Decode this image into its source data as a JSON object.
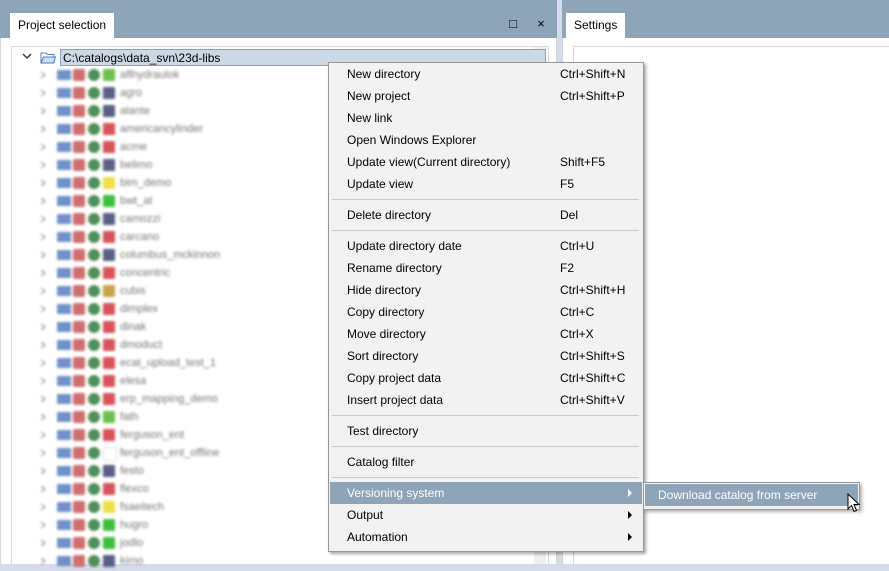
{
  "left_panel": {
    "tab_label": "Project selection",
    "restore_glyph": "□",
    "close_glyph": "×",
    "root_path": "C:\\catalogs\\data_svn\\23d-libs",
    "rows": [
      {
        "label": "aflhydraulok",
        "color": "#6fbf4d"
      },
      {
        "label": "agro",
        "color": "#5a5f86"
      },
      {
        "label": "alante",
        "color": "#5a5f86"
      },
      {
        "label": "americancylinder",
        "color": "#d9545a"
      },
      {
        "label": "acme",
        "color": "#d9545a"
      },
      {
        "label": "belimo",
        "color": "#5a5f86"
      },
      {
        "label": "bim_demo",
        "color": "#f0e04a"
      },
      {
        "label": "bwt_at",
        "color": "#3fbf3f"
      },
      {
        "label": "camozzi",
        "color": "#5a5f86"
      },
      {
        "label": "carcano",
        "color": "#d9545a"
      },
      {
        "label": "columbus_mckinnon",
        "color": "#5a5f86"
      },
      {
        "label": "concentric",
        "color": "#d9545a"
      },
      {
        "label": "cubis",
        "color": "#c8a34a"
      },
      {
        "label": "dimplex",
        "color": "#d9545a"
      },
      {
        "label": "dinak",
        "color": "#d9545a"
      },
      {
        "label": "dmoduct",
        "color": "#d9545a"
      },
      {
        "label": "ecat_upload_test_1",
        "color": "#d9545a"
      },
      {
        "label": "elesa",
        "color": "#d9545a"
      },
      {
        "label": "erp_mapping_demo",
        "color": "#d9545a"
      },
      {
        "label": "fath",
        "color": "#6fbf4d"
      },
      {
        "label": "ferguson_ent",
        "color": "#d9545a"
      },
      {
        "label": "ferguson_ent_offline",
        "color": "#ffffff"
      },
      {
        "label": "festo",
        "color": "#5a5f86"
      },
      {
        "label": "flexco",
        "color": "#d9545a"
      },
      {
        "label": "fsaeitech",
        "color": "#f0e04a"
      },
      {
        "label": "hugro",
        "color": "#3fbf3f"
      },
      {
        "label": "jodlo",
        "color": "#3fbf3f"
      },
      {
        "label": "kimo",
        "color": "#5a5f86"
      }
    ]
  },
  "right_panel": {
    "tab_label": "Settings"
  },
  "context_menu": {
    "groups": [
      [
        {
          "label": "New directory",
          "shortcut": "Ctrl+Shift+N"
        },
        {
          "label": "New project",
          "shortcut": "Ctrl+Shift+P"
        },
        {
          "label": "New link",
          "shortcut": ""
        },
        {
          "label": "Open Windows Explorer",
          "shortcut": ""
        },
        {
          "label": "Update view(Current directory)",
          "shortcut": "Shift+F5"
        },
        {
          "label": "Update view",
          "shortcut": "F5"
        }
      ],
      [
        {
          "label": "Delete directory",
          "shortcut": "Del"
        }
      ],
      [
        {
          "label": "Update directory date",
          "shortcut": "Ctrl+U"
        },
        {
          "label": "Rename directory",
          "shortcut": "F2"
        },
        {
          "label": "Hide directory",
          "shortcut": "Ctrl+Shift+H"
        },
        {
          "label": "Copy directory",
          "shortcut": "Ctrl+C"
        },
        {
          "label": "Move directory",
          "shortcut": "Ctrl+X"
        },
        {
          "label": "Sort directory",
          "shortcut": "Ctrl+Shift+S"
        },
        {
          "label": "Copy project data",
          "shortcut": "Ctrl+Shift+C"
        },
        {
          "label": "Insert project data",
          "shortcut": "Ctrl+Shift+V"
        }
      ],
      [
        {
          "label": "Test directory",
          "shortcut": ""
        }
      ],
      [
        {
          "label": "Catalog filter",
          "shortcut": ""
        }
      ],
      [
        {
          "label": "Versioning system",
          "shortcut": "",
          "submenu": true,
          "highlighted": true
        },
        {
          "label": "Output",
          "shortcut": "",
          "submenu": true
        },
        {
          "label": "Automation",
          "shortcut": "",
          "submenu": true
        }
      ]
    ]
  },
  "submenu": {
    "item_label": "Download catalog from server"
  },
  "colors": {
    "tabbar": "#8ea4b8",
    "highlight": "#8ea4b8",
    "menu_bg": "#f2f2f2"
  }
}
